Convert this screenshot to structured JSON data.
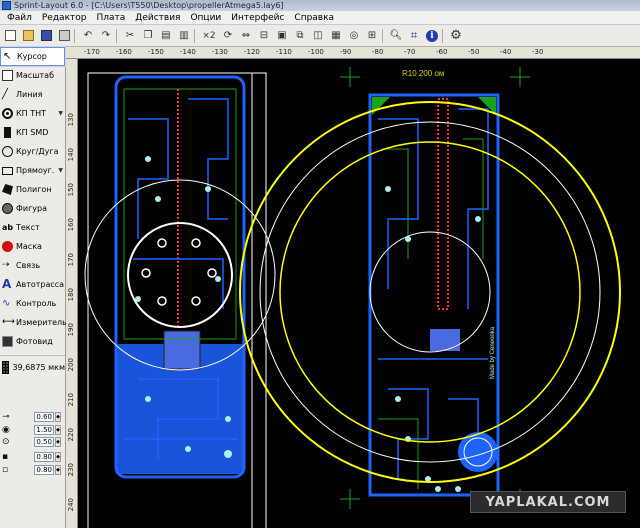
{
  "window": {
    "title": "Sprint-Layout 6.0 - [C:\\Users\\T550\\Desktop\\propellerAtmega5.lay6]"
  },
  "menu": [
    {
      "label": "Файл"
    },
    {
      "label": "Редактор"
    },
    {
      "label": "Плата"
    },
    {
      "label": "Действия"
    },
    {
      "label": "Опции"
    },
    {
      "label": "Интерфейс"
    },
    {
      "label": "Справка"
    }
  ],
  "toolbar": {
    "zoom_label": "×2",
    "icons": [
      "new-file-icon",
      "open-folder-icon",
      "save-disk-icon",
      "print-icon",
      "undo-icon",
      "redo-icon",
      "cut-icon",
      "copy-icon",
      "paste-icon",
      "delete-icon",
      "zoom-multiply-icon",
      "rotate-icon",
      "mirror-icon",
      "align-icon",
      "component-icon",
      "group-icon",
      "ungroup-icon",
      "cad-icon",
      "via-icon",
      "track-icon",
      "zoom-lens-icon",
      "autoroute-icon",
      "info-icon",
      "settings-gear-icon"
    ]
  },
  "sidebar": {
    "tools": [
      {
        "label": "Курсор",
        "icon": "cursor-icon",
        "active": true
      },
      {
        "label": "Масштаб",
        "icon": "zoom-icon"
      },
      {
        "label": "Линия",
        "icon": "line-icon"
      },
      {
        "label": "КП ТНТ",
        "icon": "tht-pad-icon",
        "dropdown": true
      },
      {
        "label": "КП SMD",
        "icon": "smd-pad-icon"
      },
      {
        "label": "Круг/Дуга",
        "icon": "circle-arc-icon"
      },
      {
        "label": "Прямоуг.",
        "icon": "rectangle-icon",
        "dropdown": true
      },
      {
        "label": "Полигон",
        "icon": "polygon-icon"
      },
      {
        "label": "Фигура",
        "icon": "shape-icon"
      },
      {
        "label": "Текст",
        "icon": "text-icon"
      },
      {
        "label": "Маска",
        "icon": "mask-icon"
      },
      {
        "label": "Связь",
        "icon": "connection-icon"
      },
      {
        "label": "Автотрасса",
        "icon": "autoroute-icon"
      },
      {
        "label": "Контроль",
        "icon": "control-icon"
      },
      {
        "label": "Измеритель",
        "icon": "measure-icon"
      },
      {
        "label": "Фотовид",
        "icon": "photoview-icon"
      }
    ],
    "grid_value": "39,6875 мкм",
    "params": [
      {
        "icon": "track-width-icon",
        "value": "0.60"
      },
      {
        "icon": "pad-outer-icon",
        "value": "1.50"
      },
      {
        "icon": "pad-inner-icon",
        "value": "0.50"
      },
      {
        "icon": "smd-width-icon",
        "value": "0.80"
      },
      {
        "icon": "smd-height-icon",
        "value": "0.80"
      }
    ]
  },
  "ruler": {
    "top_labels": [
      "-170",
      "-160",
      "-150",
      "-140",
      "-130",
      "-120",
      "-110",
      "-100",
      "-90",
      "-80",
      "-70",
      "-60",
      "-50",
      "-40",
      "-30"
    ],
    "left_labels": [
      "130",
      "140",
      "150",
      "160",
      "170",
      "180",
      "190",
      "200",
      "210",
      "220",
      "230",
      "240"
    ]
  },
  "canvas": {
    "annotation": "R10 200 ом",
    "board_text": "Made by Ceneonka"
  },
  "colors": {
    "copper_top": "#1e63ff",
    "copper_bottom": "#19a319",
    "silk": "#e0e000",
    "pads": "#a8f0f0",
    "drill_ring": "#ffffff",
    "annotation_text": "#d4d400"
  },
  "watermark": {
    "text": "YAPLAKAL.COM"
  }
}
